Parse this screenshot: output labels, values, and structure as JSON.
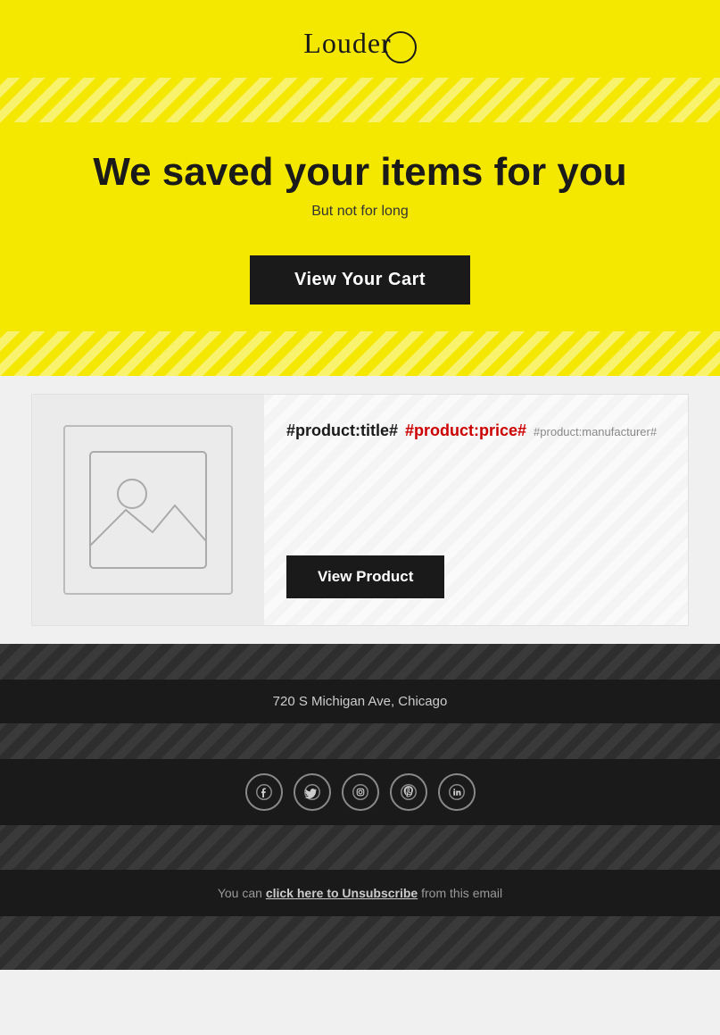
{
  "header": {
    "logo_text": "Louder",
    "logo_circle_aria": "logo-circle"
  },
  "hero": {
    "headline": "We saved your items for you",
    "subheadline": "But not for long",
    "cta_label": "View Your Cart"
  },
  "product": {
    "title": "#product:title#",
    "price": "#product:price#",
    "manufacturer": "#product:manufacturer#",
    "view_button_label": "View Product",
    "image_alt": "Product image placeholder"
  },
  "footer": {
    "address": "720 S Michigan Ave, Chicago",
    "social_icons": [
      {
        "name": "facebook-icon",
        "symbol": "f"
      },
      {
        "name": "twitter-icon",
        "symbol": "t"
      },
      {
        "name": "instagram-icon",
        "symbol": "i"
      },
      {
        "name": "pinterest-icon",
        "symbol": "p"
      },
      {
        "name": "linkedin-icon",
        "symbol": "in"
      }
    ],
    "unsub_text_before": "You can ",
    "unsub_link_text": "click here to Unsubscribe",
    "unsub_text_after": " from this email"
  }
}
